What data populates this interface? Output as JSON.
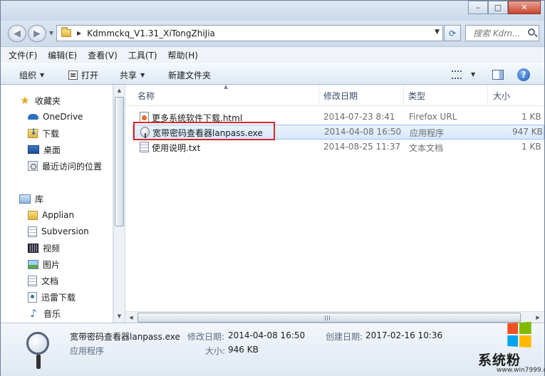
{
  "window": {
    "controls": [
      "–",
      "□",
      "✕"
    ]
  },
  "address": {
    "path": "Kdmmckq_V1.31_XiTongZhiJia",
    "search_placeholder": "搜索 Kdm..."
  },
  "menu": [
    "文件(F)",
    "编辑(E)",
    "查看(V)",
    "工具(T)",
    "帮助(H)"
  ],
  "toolbar": {
    "organize": "组织",
    "open": "打开",
    "share": "共享",
    "new_folder": "新建文件夹"
  },
  "nav": {
    "favorites": "收藏夹",
    "onedrive": "OneDrive",
    "downloads": "下载",
    "desktop": "桌面",
    "recent": "最近访问的位置",
    "libraries": "库",
    "applian": "Applian",
    "subversion": "Subversion",
    "videos": "视频",
    "pictures": "图片",
    "documents": "文档",
    "thunder": "迅雷下载",
    "music": "音乐"
  },
  "columns": {
    "name": "名称",
    "modified": "修改日期",
    "type": "类型",
    "size": "大小"
  },
  "files": [
    {
      "name": "更多系统软件下载.html",
      "date": "2014-07-23 8:41",
      "type": "Firefox URL",
      "size": "1 KB",
      "icon": "html-file-icon"
    },
    {
      "name": "宽带密码查看器lanpass.exe",
      "date": "2014-04-08 16:50",
      "type": "应用程序",
      "size": "947 KB",
      "icon": "magnifier-exe-icon",
      "selected": true
    },
    {
      "name": "使用说明.txt",
      "date": "2014-08-25 11:37",
      "type": "文本文档",
      "size": "1 KB",
      "icon": "text-file-icon"
    }
  ],
  "details": {
    "filename": "宽带密码查看器lanpass.exe",
    "filetype": "应用程序",
    "modified_label": "修改日期:",
    "modified_value": "2014-04-08 16:50",
    "created_label": "创建日期:",
    "created_value": "2017-02-16 10:36",
    "size_label": "大小:",
    "size_value": "946 KB"
  },
  "watermark": {
    "text": "系统粉",
    "url": "www.win7999.com"
  }
}
